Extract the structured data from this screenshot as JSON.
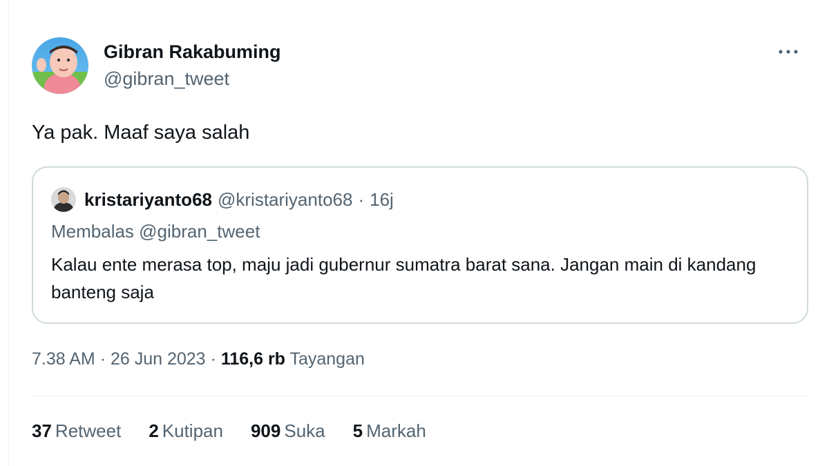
{
  "tweet": {
    "author_name": "Gibran Rakabuming",
    "author_handle": "@gibran_tweet",
    "text": "Ya pak. Maaf saya salah",
    "more_icon": "more-horizontal-icon",
    "quote": {
      "author_name": "kristariyanto68",
      "author_handle": "@kristariyanto68",
      "separator": "·",
      "time": "16j",
      "reply_to": "Membalas @gibran_tweet",
      "text": "Kalau ente merasa top, maju jadi gubernur sumatra barat sana. Jangan main di kandang banteng saja"
    },
    "meta": {
      "time": "7.38 AM",
      "separator": "·",
      "date": "26 Jun 2023",
      "views_count": "116,6 rb",
      "views_label": "Tayangan"
    },
    "stats": [
      {
        "count": "37",
        "label": "Retweet"
      },
      {
        "count": "2",
        "label": "Kutipan"
      },
      {
        "count": "909",
        "label": "Suka"
      },
      {
        "count": "5",
        "label": "Markah"
      }
    ]
  },
  "colors": {
    "text_primary": "#0f1419",
    "text_secondary": "#536471",
    "border": "#cfd9de",
    "divider": "#eff3f4"
  }
}
